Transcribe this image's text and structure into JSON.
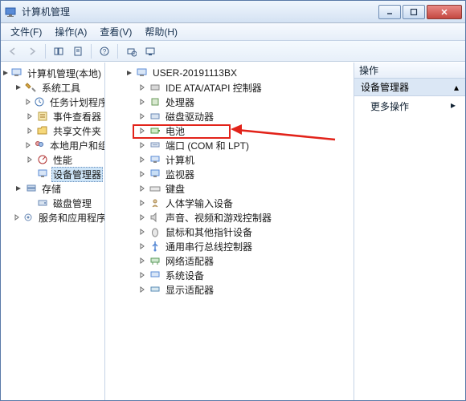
{
  "window": {
    "title": "计算机管理"
  },
  "menu": {
    "file": "文件(F)",
    "action": "操作(A)",
    "view": "查看(V)",
    "help": "帮助(H)"
  },
  "left_tree": {
    "root": "计算机管理(本地)",
    "group_tools": "系统工具",
    "tools": {
      "task_scheduler": "任务计划程序",
      "event_viewer": "事件查看器",
      "shared_folders": "共享文件夹",
      "local_users": "本地用户和组",
      "performance": "性能",
      "device_manager": "设备管理器"
    },
    "group_storage": "存储",
    "storage": {
      "disk_mgmt": "磁盘管理"
    },
    "group_services": "服务和应用程序"
  },
  "middle_tree": {
    "root": "USER-20191113BX",
    "items": {
      "ide": "IDE ATA/ATAPI 控制器",
      "cpu": "处理器",
      "disk_drive": "磁盘驱动器",
      "battery": "电池",
      "ports": "端口 (COM 和 LPT)",
      "computer": "计算机",
      "monitor": "监视器",
      "keyboard": "键盘",
      "hid": "人体学输入设备",
      "sound": "声音、视频和游戏控制器",
      "mouse": "鼠标和其他指针设备",
      "usb": "通用串行总线控制器",
      "network": "网络适配器",
      "system": "系统设备",
      "display": "显示适配器"
    }
  },
  "right_panel": {
    "header": "操作",
    "selected": "设备管理器",
    "more": "更多操作"
  }
}
